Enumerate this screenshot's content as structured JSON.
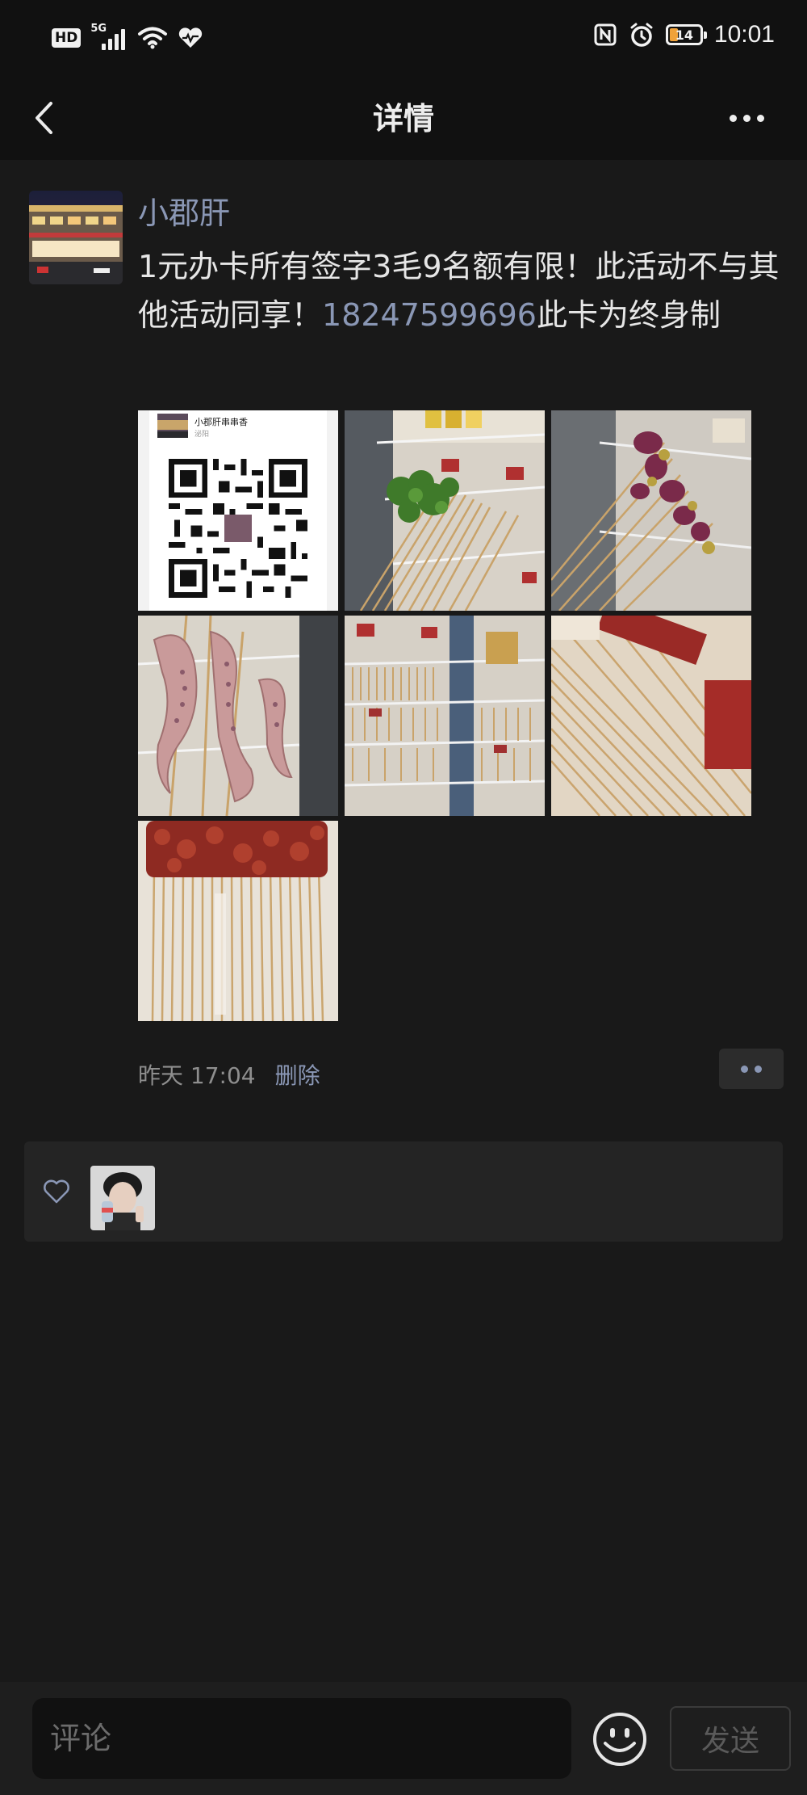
{
  "status_bar": {
    "hd_label": "HD",
    "network_label": "5G",
    "battery_level": "14",
    "time": "10:01"
  },
  "nav": {
    "title": "详情",
    "back_icon": "chevron-left-icon",
    "more_icon": "more-horizontal-icon"
  },
  "post": {
    "author": "小郡肝",
    "text_before_phone": "1元办卡所有签字3毛9名额有限！此活动不与其他活动同享！",
    "phone": "18247599696",
    "text_after_phone": "此卡为终身制",
    "qr_card": {
      "shop_name": "小郡肝串串香",
      "location": "泌阳"
    },
    "photos": [
      {
        "name": "qr-code-card"
      },
      {
        "name": "fridge-herbs-skewers"
      },
      {
        "name": "purple-vegetable-skewers"
      },
      {
        "name": "squid-tentacle-skewers"
      },
      {
        "name": "fridge-shelves-skewers"
      },
      {
        "name": "red-meat-skewers-tray"
      },
      {
        "name": "beef-skewers-bundle"
      }
    ],
    "time": "昨天 17:04",
    "delete_label": "删除"
  },
  "likes": {
    "icon": "heart-outline-icon",
    "count": 1
  },
  "comment_bar": {
    "placeholder": "评论",
    "emoji_icon": "smiley-icon",
    "send_label": "发送"
  },
  "colors": {
    "background": "#191919",
    "bar": "#111111",
    "link_blue": "#8a97b5",
    "text": "#e6e6e6"
  }
}
